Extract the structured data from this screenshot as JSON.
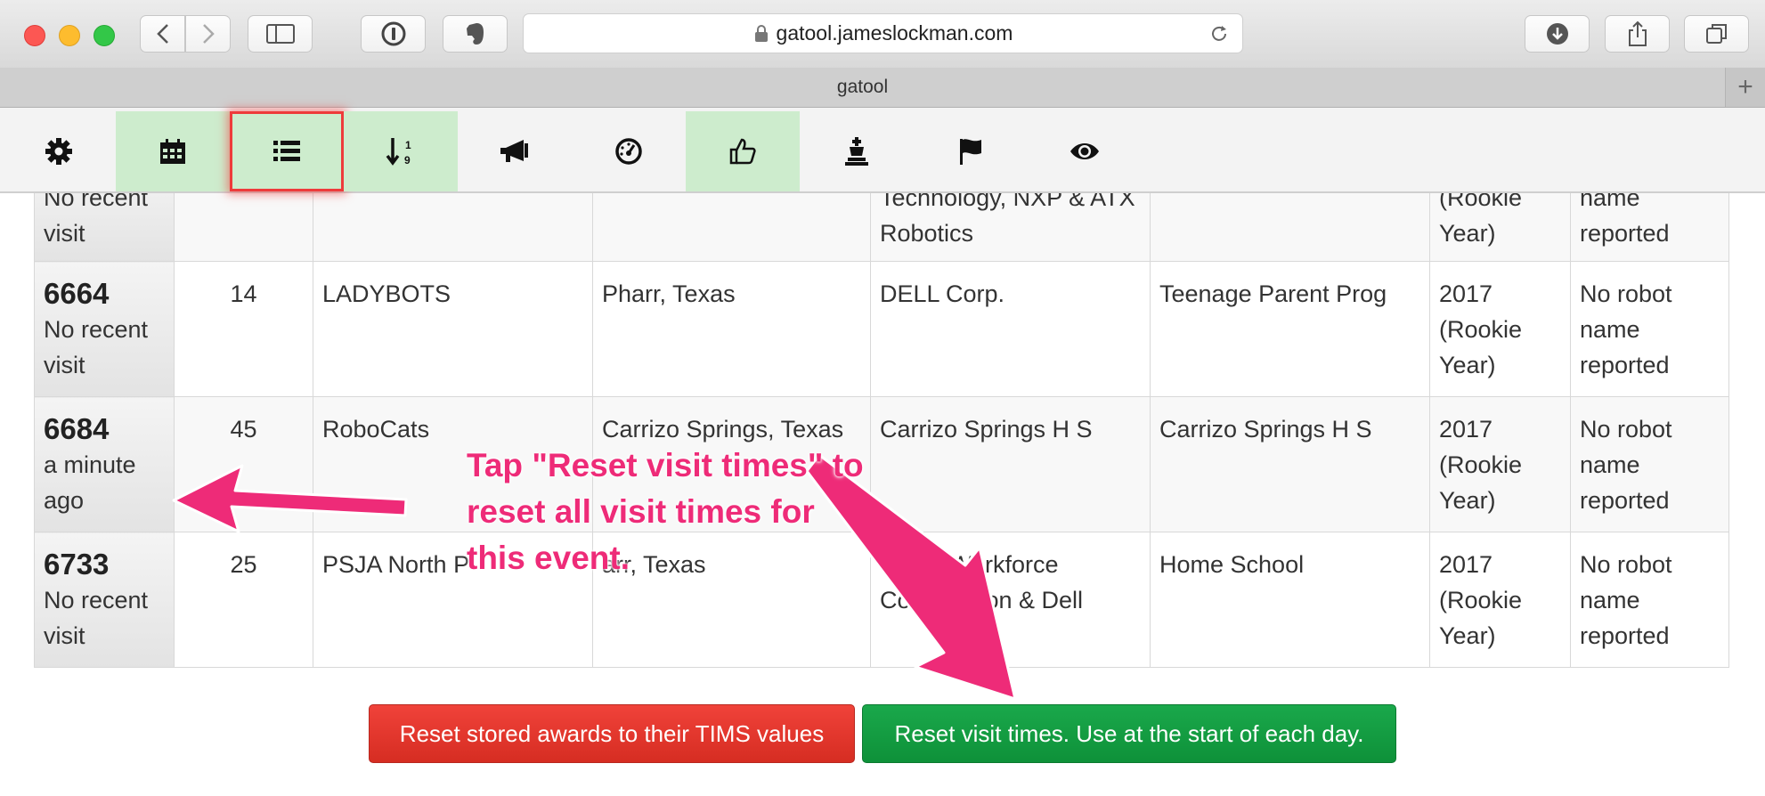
{
  "browser": {
    "url": "gatool.jameslockman.com",
    "tab_title": "gatool",
    "new_tab": "+"
  },
  "toolbar": {
    "icons": [
      "gear-icon",
      "calendar-icon",
      "list-icon",
      "sort-numeric-icon",
      "megaphone-icon",
      "dashboard-icon",
      "thumbs-up-icon",
      "trophy-icon",
      "flag-icon",
      "eye-icon"
    ],
    "active": "list-icon",
    "highlighted": [
      "calendar-icon",
      "list-icon",
      "sort-numeric-icon",
      "thumbs-up-icon"
    ]
  },
  "table": {
    "rows": [
      {
        "team": "",
        "visit": "No recent visit",
        "count": "",
        "name": "",
        "location": "",
        "sponsor": "Technology, NXP & ATX Robotics",
        "org": "",
        "rookie": "(Rookie Year)",
        "robot": "name reported"
      },
      {
        "team": "6664",
        "visit": "No recent visit",
        "count": "14",
        "name": "LADYBOTS",
        "location": "Pharr, Texas",
        "sponsor": "DELL Corp.",
        "org": "Teenage Parent Prog",
        "rookie": "2017 (Rookie Year)",
        "robot": "No robot name reported"
      },
      {
        "team": "6684",
        "visit": "a minute ago",
        "count": "45",
        "name": "RoboCats",
        "location": "Carrizo Springs, Texas",
        "sponsor": "Carrizo Springs H S",
        "org": "Carrizo Springs H S",
        "rookie": "2017 (Rookie Year)",
        "robot": "No robot name reported"
      },
      {
        "team": "6733",
        "visit": "No recent visit",
        "count": "25",
        "name": "PSJA North P",
        "location": "arr, Texas",
        "sponsor": "Texas Workforce Commission & Dell",
        "org": "Home School",
        "rookie": "2017 (Rookie Year)",
        "robot": "No robot name reported"
      }
    ]
  },
  "buttons": {
    "reset_awards": "Reset stored awards to their TIMS values",
    "reset_visits": "Reset visit times. Use at the start of each day."
  },
  "annotation": {
    "line1": "Tap \"Reset visit times\" to",
    "line2": "reset all visit times for",
    "line3": "this event.",
    "color": "#ee2b78"
  }
}
